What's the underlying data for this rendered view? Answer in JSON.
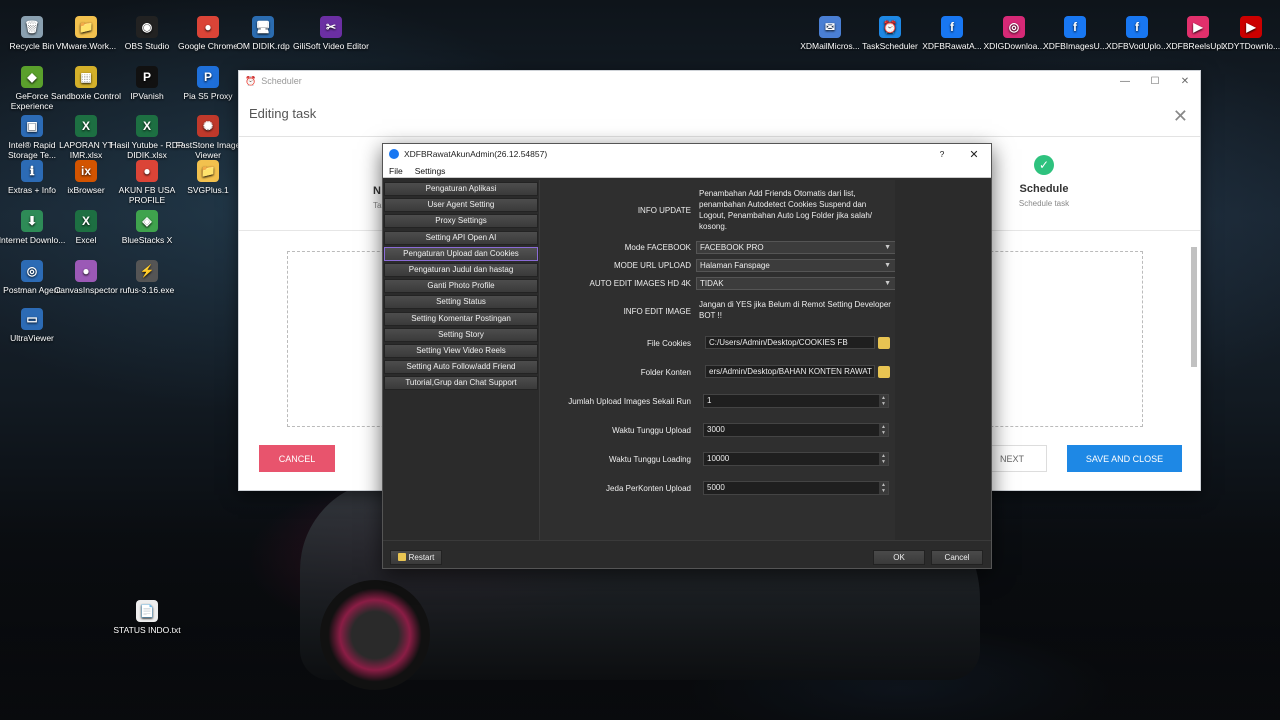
{
  "desktop": {
    "icons_left": [
      {
        "label": "Recycle Bin",
        "color": "#8aa0b0",
        "glyph": "🗑"
      },
      {
        "label": "VMware.Work...",
        "color": "#f2c14e",
        "glyph": "📁"
      },
      {
        "label": "OBS Studio",
        "color": "#222222",
        "glyph": "◉"
      },
      {
        "label": "Google Chrome",
        "color": "#db4437",
        "glyph": "●"
      },
      {
        "label": "OM DIDIK.rdp",
        "color": "#2b6cb0",
        "glyph": "🖥"
      },
      {
        "label": "GiliSoft Video Editor",
        "color": "#6b2fa3",
        "glyph": "✂"
      },
      {
        "label": "GeForce Experience",
        "color": "#5aa02c",
        "glyph": "◆"
      },
      {
        "label": "Sandboxie Control",
        "color": "#d4b02a",
        "glyph": "▦"
      },
      {
        "label": "IPVanish",
        "color": "#111111",
        "glyph": "P"
      },
      {
        "label": "Pia S5 Proxy",
        "color": "#1e6fd9",
        "glyph": "P"
      },
      {
        "label": "Intel® Rapid Storage Te...",
        "color": "#2c6bb5",
        "glyph": "▣"
      },
      {
        "label": "LAPORAN YT IMR.xlsx",
        "color": "#1d6f42",
        "glyph": "X"
      },
      {
        "label": "Hasil Yutube - RDP DIDIK.xlsx",
        "color": "#1d6f42",
        "glyph": "X"
      },
      {
        "label": "FastStone Image Viewer",
        "color": "#c0392b",
        "glyph": "✺"
      },
      {
        "label": "Extras + Info",
        "color": "#2c6bb5",
        "glyph": "ℹ"
      },
      {
        "label": "ixBrowser",
        "color": "#d35400",
        "glyph": "ix"
      },
      {
        "label": "AKUN FB USA PROFILE",
        "color": "#db4437",
        "glyph": "●"
      },
      {
        "label": "SVGPlus.1",
        "color": "#f2c14e",
        "glyph": "📁"
      },
      {
        "label": "Internet Downlo...",
        "color": "#2e8b57",
        "glyph": "⬇"
      },
      {
        "label": "Excel",
        "color": "#1d6f42",
        "glyph": "X"
      },
      {
        "label": "BlueStacks X",
        "color": "#3fa34d",
        "glyph": "◈"
      },
      {
        "label": "Postman Agent",
        "color": "#2c6bb5",
        "glyph": "◎"
      },
      {
        "label": "CanvasInspector",
        "color": "#9b59b6",
        "glyph": "●"
      },
      {
        "label": "rufus-3.16.exe",
        "color": "#555555",
        "glyph": "⚡"
      },
      {
        "label": "UltraViewer",
        "color": "#2c6bb5",
        "glyph": "▭"
      },
      {
        "label": "STATUS INDO.txt",
        "color": "#eeeeee",
        "glyph": "📄"
      }
    ],
    "icons_right": [
      {
        "label": "XDMailMicros...",
        "color": "#4a7fd4",
        "glyph": "✉"
      },
      {
        "label": "TaskScheduler",
        "color": "#1e88e5",
        "glyph": "⏰"
      },
      {
        "label": "XDFBRawatA...",
        "color": "#1877f2",
        "glyph": "f"
      },
      {
        "label": "XDIGDownloa...",
        "color": "#d62976",
        "glyph": "◎"
      },
      {
        "label": "XDFBImagesU...",
        "color": "#1877f2",
        "glyph": "f"
      },
      {
        "label": "XDFBVodUplo...",
        "color": "#1877f2",
        "glyph": "f"
      },
      {
        "label": "XDFBReelsUpl...",
        "color": "#e1306c",
        "glyph": "▶"
      },
      {
        "label": "XDYTDownlo...",
        "color": "#cc0000",
        "glyph": "▶"
      }
    ]
  },
  "scheduler": {
    "title": "Scheduler",
    "heading": "Editing task",
    "step_partial_left": "N",
    "step_partial_left_sub": "Tas",
    "step_schedule": {
      "title": "Schedule",
      "subtitle": "Schedule task"
    },
    "cancel_label": "CANCEL",
    "next_label": "NEXT",
    "save_label": "SAVE AND CLOSE"
  },
  "xdfb": {
    "title": "XDFBRawatAkunAdmin(26.12.54857)",
    "help": "?",
    "close": "✕",
    "menu": [
      "File",
      "Settings"
    ],
    "nav": [
      "Pengaturan Aplikasi",
      "User Agent Setting",
      "Proxy Settings",
      "Setting API Open AI",
      "Pengaturan Upload dan Cookies",
      "Pengaturan Judul dan hastag",
      "Ganti Photo Profile",
      "Setting Status",
      "Setting Komentar Postingan",
      "Setting Story",
      "Setting View Video Reels",
      "Setting Auto Follow/add Friend",
      "Tutorial,Grup dan Chat Support"
    ],
    "active_nav": 4,
    "form": {
      "info_update_label": "INFO UPDATE",
      "info_update_text": "Penambahan Add Friends Otomatis dari list, penambahan Autodetect Cookies Suspend dan Logout, Penambahan Auto Log Folder jika salah/ kosong.",
      "mode_facebook_label": "Mode FACEBOOK",
      "mode_facebook_value": "FACEBOOK PRO",
      "mode_url_label": "MODE URL UPLOAD",
      "mode_url_value": "Halaman Fanspage",
      "auto_edit_label": "AUTO EDIT IMAGES HD 4K",
      "auto_edit_value": "TIDAK",
      "info_edit_label": "INFO EDIT IMAGE",
      "info_edit_text": "Jangan di YES jika Belum di Remot Setting Developer BOT !!",
      "file_cookies_label": "File Cookies",
      "file_cookies_value": "C:/Users/Admin/Desktop/COOKIES FB",
      "folder_konten_label": "Folder Konten",
      "folder_konten_value": "ers/Admin/Desktop/BAHAN KONTEN RAWAT",
      "jumlah_label": "Jumlah Upload Images Sekali Run",
      "jumlah_value": "1",
      "tunggu_upload_label": "Waktu Tunggu Upload",
      "tunggu_upload_value": "3000",
      "tunggu_loading_label": "Waktu Tunggu Loading",
      "tunggu_loading_value": "10000",
      "jeda_label": "Jeda PerKonten Upload",
      "jeda_value": "5000"
    },
    "restart_label": "Restart",
    "ok_label": "OK",
    "cancel_label": "Cancel"
  }
}
